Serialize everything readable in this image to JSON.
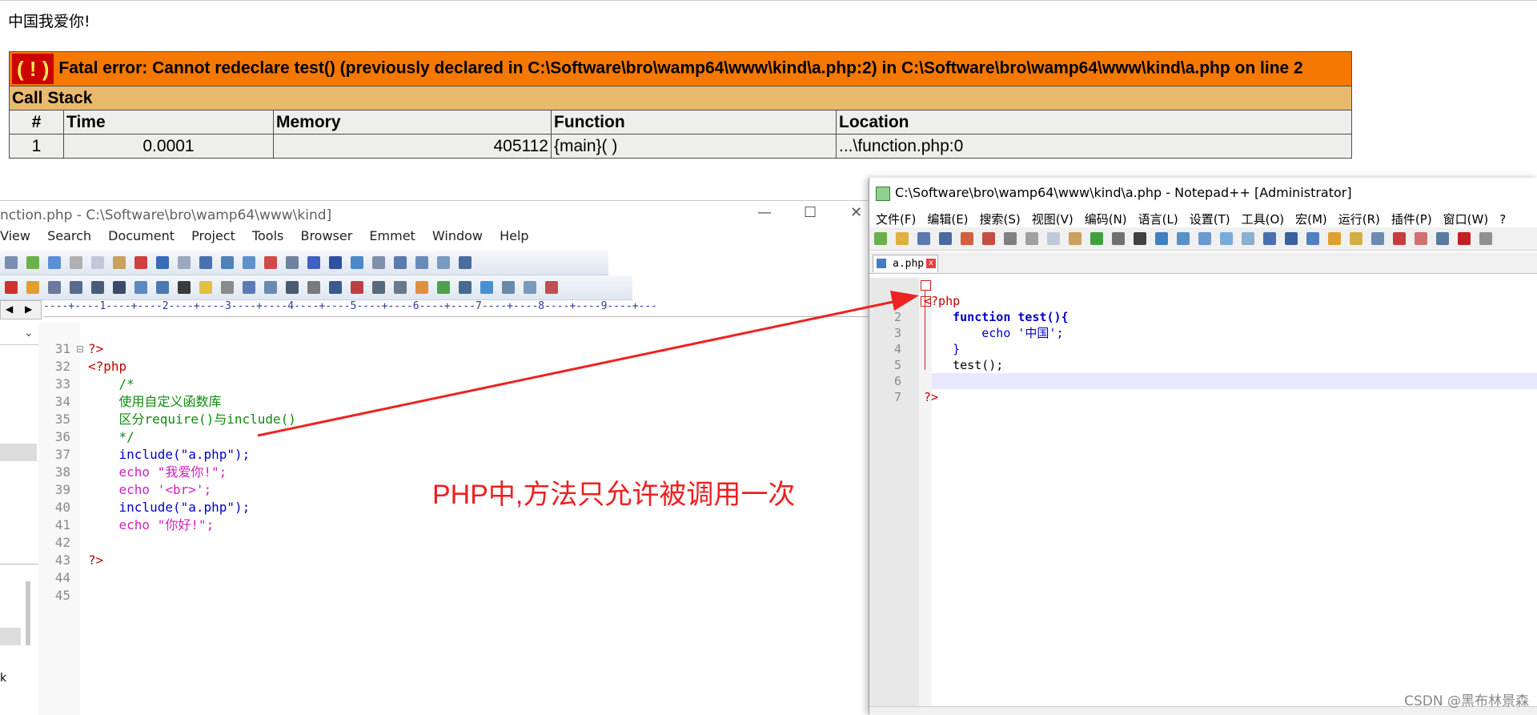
{
  "browser": {
    "echo_text": "中国我爱你!",
    "error_icon": "( ! )",
    "error_message": "Fatal error: Cannot redeclare test() (previously declared in C:\\Software\\bro\\wamp64\\www\\kind\\a.php:2) in C:\\Software\\bro\\wamp64\\www\\kind\\a.php on line 2",
    "call_stack_label": "Call Stack",
    "columns": [
      "#",
      "Time",
      "Memory",
      "Function",
      "Location"
    ],
    "rows": [
      {
        "num": "1",
        "time": "0.0001",
        "memory": "405112",
        "function": "{main}( )",
        "location": "...\\function.php:0"
      }
    ]
  },
  "left_editor": {
    "title": "nction.php - C:\\Software\\bro\\wamp64\\www\\kind]",
    "menu": [
      "View",
      "Search",
      "Document",
      "Project",
      "Tools",
      "Browser",
      "Emmet",
      "Window",
      "Help"
    ],
    "ruler": "----+----1----+----2----+----3----+----4----+----5----+----6----+----7----+----8----+----9----+---",
    "side_letter": "k",
    "lines": [
      {
        "n": "31",
        "text": "?>"
      },
      {
        "n": "32",
        "text": "<?php"
      },
      {
        "n": "33",
        "text": "    /*"
      },
      {
        "n": "34",
        "text": "    使用自定义函数库"
      },
      {
        "n": "35",
        "text": "    区分require()与include()"
      },
      {
        "n": "36",
        "text": "    */"
      },
      {
        "n": "37",
        "text": "    include(\"a.php\");"
      },
      {
        "n": "38",
        "text": "    echo \"我爱你!\";"
      },
      {
        "n": "39",
        "text": "    echo '<br>';"
      },
      {
        "n": "40",
        "text": "    include(\"a.php\");"
      },
      {
        "n": "41",
        "text": "    echo \"你好!\";"
      },
      {
        "n": "42",
        "text": ""
      },
      {
        "n": "43",
        "text": "?>"
      },
      {
        "n": "44",
        "text": ""
      },
      {
        "n": "45",
        "text": ""
      }
    ]
  },
  "npp": {
    "title": "C:\\Software\\bro\\wamp64\\www\\kind\\a.php - Notepad++ [Administrator]",
    "menu": [
      "文件(F)",
      "编辑(E)",
      "搜索(S)",
      "视图(V)",
      "编码(N)",
      "语言(L)",
      "设置(T)",
      "工具(O)",
      "宏(M)",
      "运行(R)",
      "插件(P)",
      "窗口(W)",
      "?"
    ],
    "tab_label": "a.php",
    "lines": [
      {
        "n": "1",
        "text": "<?php"
      },
      {
        "n": "2",
        "text": "    function test(){"
      },
      {
        "n": "3",
        "text": "        echo '中国';"
      },
      {
        "n": "4",
        "text": "    }"
      },
      {
        "n": "5",
        "text": "    test();"
      },
      {
        "n": "6",
        "text": ""
      },
      {
        "n": "7",
        "text": "?>"
      }
    ]
  },
  "annotation": {
    "text": "PHP中,方法只允许被调用一次",
    "color": "#ee2020"
  },
  "watermark": "CSDN @黑布林景森",
  "colors": {
    "error_bg": "#f57900",
    "callstack_bg": "#e9b96e",
    "row_bg": "#eeeeec"
  }
}
